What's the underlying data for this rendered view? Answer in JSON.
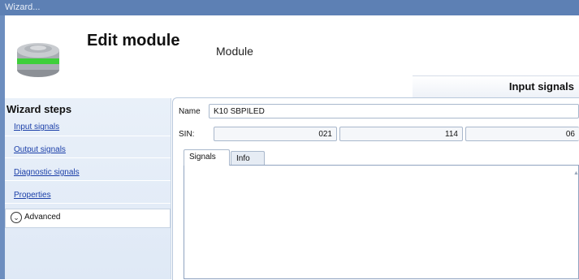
{
  "window": {
    "title": "Wizard..."
  },
  "header": {
    "title": "Edit module",
    "subtitle": "Module",
    "tab_label": "Input signals"
  },
  "sidebar": {
    "title": "Wizard steps",
    "steps": [
      {
        "label": "Input signals"
      },
      {
        "label": "Output signals"
      },
      {
        "label": "Diagnostic signals"
      },
      {
        "label": "Properties"
      }
    ],
    "advanced_label": "Advanced"
  },
  "form": {
    "name_label": "Name",
    "name_value": "K10 SBPILED",
    "sin_label": "SIN:",
    "sin_values": [
      "021",
      "114",
      "06"
    ]
  },
  "tabs": [
    {
      "label": "Signals"
    },
    {
      "label": "Info"
    }
  ],
  "colors": {
    "titlebar": "#5d80b4",
    "link": "#1a3ea8",
    "sidebar_bg": "#e6eef8"
  },
  "icons": {
    "module": "module-device-icon",
    "advanced": "chevron-down-circle-icon"
  }
}
